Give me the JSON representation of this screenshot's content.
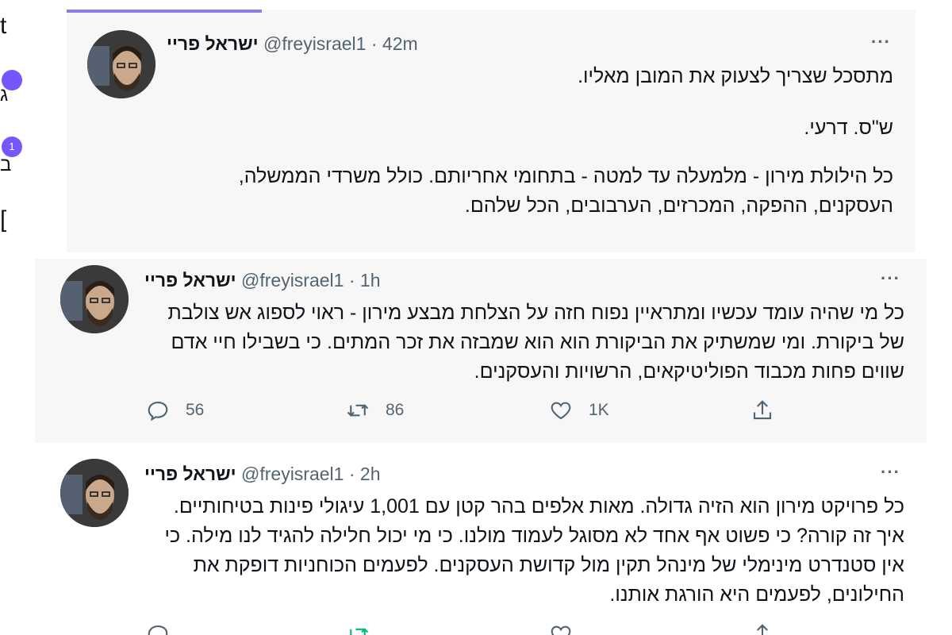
{
  "nav": {
    "badges": [
      "",
      "1"
    ]
  },
  "tweets": [
    {
      "name": "ישראל פריי",
      "handle": "@freyisrael1",
      "sep": "·",
      "time": "42m",
      "more": "···",
      "paragraphs": [
        "מתסכל שצריך לצעוק את המובן מאליו.",
        "ש\"ס. דרעי.",
        "כל הילולת מירון - מלמעלה עד למטה - בתחומי אחריותם. כולל משרדי הממשלה, העסקנים, ההפקה, המכרזים, הערבובים, הכל שלהם."
      ]
    },
    {
      "name": "ישראל פריי",
      "handle": "@freyisrael1",
      "sep": "·",
      "time": "1h",
      "more": "···",
      "text": "כל מי שהיה עומד עכשיו ומתראיין נפוח חזה על הצלחת מבצע מירון - ראוי לספוג אש צולבת של ביקורת. ומי שמשתיק את הביקורת הוא הוא שמבזה את זכר המתים. כי בשבילו חיי אדם שווים פחות מכבוד הפוליטיקאים, הרשויות והעסקנים.",
      "replies": "56",
      "retweets": "86",
      "likes": "1K"
    },
    {
      "name": "ישראל פריי",
      "handle": "@freyisrael1",
      "sep": "·",
      "time": "2h",
      "more": "···",
      "text": "כל פרויקט מירון הוא הזיה גדולה. מאות אלפים בהר קטן עם 1,001 עיגולי פינות בטיחותיים. איך זה קורה? כי פשוט אף אחד לא מסוגל לעמוד מולנו. כי מי יכול חלילה להגיד לנו מילה. כי אין סטנדרט מינימלי של מינהל תקין מול קדושת העסקנים. לפעמים הכוחניות דופקת את החילונים, לפעמים היא הורגת אותנו."
    }
  ],
  "colors": {
    "text": "#0f1419",
    "secondary": "#536471",
    "badge": "#7856ff",
    "retweet_active": "#00ba7c",
    "tab_indicator": "#8c7ee0"
  }
}
